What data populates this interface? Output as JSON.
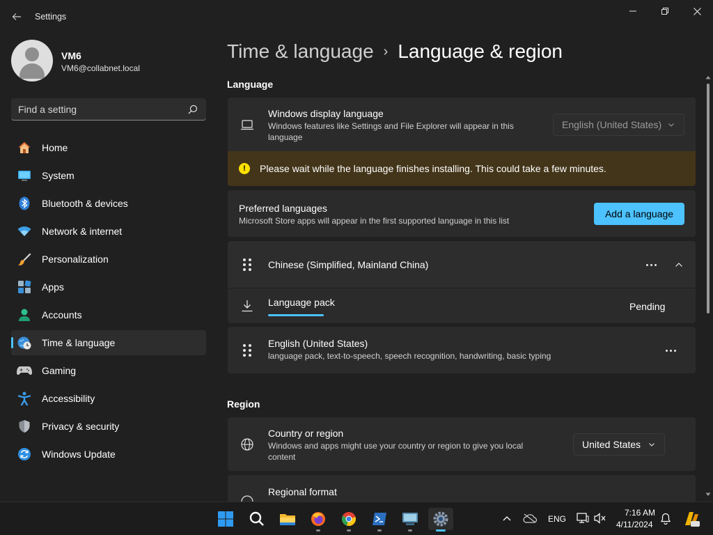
{
  "window": {
    "title": "Settings",
    "controls": [
      "minimize",
      "restore",
      "close"
    ]
  },
  "profile": {
    "name": "VM6",
    "email": "VM6@collabnet.local"
  },
  "search": {
    "placeholder": "Find a setting"
  },
  "sidebar": {
    "items": [
      {
        "label": "Home",
        "icon": "home-icon"
      },
      {
        "label": "System",
        "icon": "system-icon"
      },
      {
        "label": "Bluetooth & devices",
        "icon": "bluetooth-icon"
      },
      {
        "label": "Network & internet",
        "icon": "wifi-icon"
      },
      {
        "label": "Personalization",
        "icon": "brush-icon"
      },
      {
        "label": "Apps",
        "icon": "apps-icon"
      },
      {
        "label": "Accounts",
        "icon": "accounts-icon"
      },
      {
        "label": "Time & language",
        "icon": "time-language-icon",
        "active": true
      },
      {
        "label": "Gaming",
        "icon": "gamepad-icon"
      },
      {
        "label": "Accessibility",
        "icon": "accessibility-icon"
      },
      {
        "label": "Privacy & security",
        "icon": "shield-icon"
      },
      {
        "label": "Windows Update",
        "icon": "update-icon"
      }
    ]
  },
  "breadcrumb": {
    "parent": "Time & language",
    "separator": "›",
    "current": "Language & region"
  },
  "language_section": {
    "title": "Language",
    "display_language": {
      "title": "Windows display language",
      "description": "Windows features like Settings and File Explorer will appear in this language",
      "value": "English (United States)"
    },
    "warning": "Please wait while the language finishes installing. This could take a few minutes.",
    "preferred": {
      "title": "Preferred languages",
      "description": "Microsoft Store apps will appear in the first supported language in this list",
      "button": "Add a language"
    },
    "languages": [
      {
        "name": "Chinese (Simplified, Mainland China)",
        "expanded": true,
        "sub_item": {
          "label": "Language pack",
          "status": "Pending"
        }
      },
      {
        "name": "English (United States)",
        "description": "language pack, text-to-speech, speech recognition, handwriting, basic typing"
      }
    ]
  },
  "region_section": {
    "title": "Region",
    "country": {
      "title": "Country or region",
      "description": "Windows and apps might use your country or region to give you local content",
      "value": "United States"
    },
    "format": {
      "title": "Regional format"
    }
  },
  "taskbar": {
    "apps": [
      "windows-start",
      "search",
      "file-explorer",
      "firefox",
      "chrome",
      "powershell",
      "remote-desktop",
      "settings"
    ],
    "active_app": "settings",
    "language": "ENG",
    "time": "7:16 AM",
    "date": "4/11/2024"
  },
  "colors": {
    "accent": "#4cc2ff",
    "warning_bg": "#433519",
    "warning_icon": "#fce100",
    "background": "#202020",
    "card": "#2b2b2b"
  }
}
